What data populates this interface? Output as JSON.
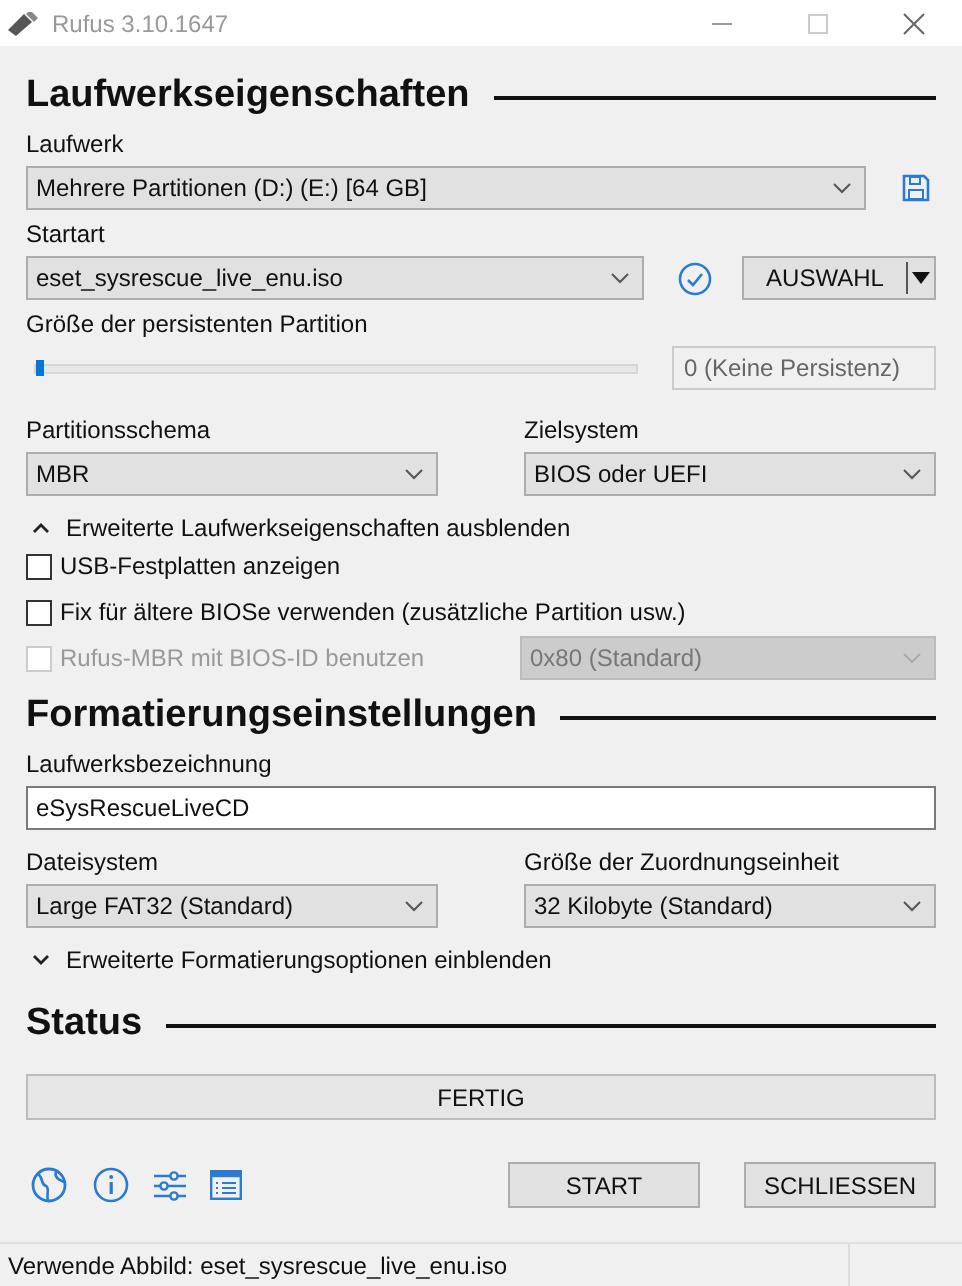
{
  "window": {
    "title": "Rufus 3.10.1647"
  },
  "drive_properties": {
    "heading": "Laufwerkseigenschaften",
    "drive": {
      "label": "Laufwerk",
      "value": "Mehrere Partitionen (D:) (E:) [64 GB]"
    },
    "boot": {
      "label": "Startart",
      "value": "eset_sysrescue_live_enu.iso",
      "select_button": "AUSWAHL"
    },
    "persistence": {
      "label": "Größe der persistenten Partition",
      "level": 0,
      "value": "0 (Keine Persistenz)"
    },
    "partition_scheme": {
      "label": "Partitionsschema",
      "value": "MBR"
    },
    "target_system": {
      "label": "Zielsystem",
      "value": "BIOS oder UEFI"
    },
    "advanced_toggle": {
      "label": "Erweiterte Laufwerkseigenschaften ausblenden",
      "expanded": true
    },
    "options": [
      {
        "label": "USB-Festplatten anzeigen",
        "checked": false,
        "disabled": false
      },
      {
        "label": "Fix für ältere BIOSe verwenden (zusätzliche Partition usw.)",
        "checked": false,
        "disabled": false
      },
      {
        "label": "Rufus-MBR mit BIOS-ID benutzen",
        "checked": false,
        "disabled": true
      }
    ],
    "bios_id": {
      "value": "0x80 (Standard)",
      "disabled": true
    }
  },
  "format_options": {
    "heading": "Formatierungseinstellungen",
    "volume_label": {
      "label": "Laufwerksbezeichnung",
      "value": "eSysRescueLiveCD"
    },
    "file_system": {
      "label": "Dateisystem",
      "value": "Large FAT32 (Standard)"
    },
    "cluster_size": {
      "label": "Größe der Zuordnungseinheit",
      "value": "32 Kilobyte (Standard)"
    },
    "advanced_toggle": {
      "label": "Erweiterte Formatierungsoptionen einblenden",
      "expanded": false
    }
  },
  "status": {
    "heading": "Status",
    "progress": {
      "text": "FERTIG"
    }
  },
  "buttons": [
    {
      "label": "START"
    },
    {
      "label": "SCHLIESSEN"
    }
  ],
  "status_bar": {
    "text": "Verwende Abbild: eset_sysrescue_live_enu.iso"
  }
}
